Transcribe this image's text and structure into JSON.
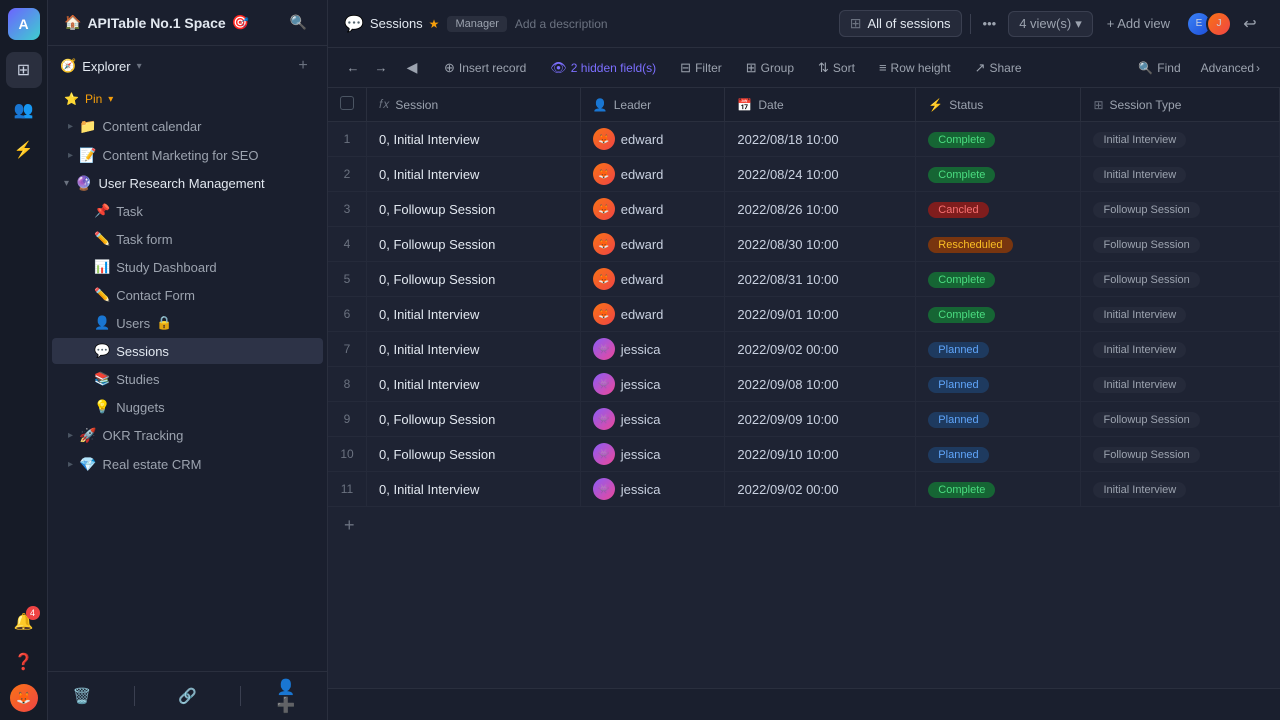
{
  "app": {
    "space_name": "APITable No.1 Space",
    "user_initial": "A"
  },
  "topbar": {
    "sessions_label": "Sessions",
    "star_label": "★",
    "manager_label": "Manager",
    "add_description": "Add a description",
    "view_name": "All of sessions",
    "view_count": "4 view(s)",
    "add_view": "+ Add view",
    "find_label": "Find",
    "advanced_label": "Advanced"
  },
  "toolbar": {
    "insert_record": "Insert record",
    "hidden_fields": "2 hidden field(s)",
    "filter": "Filter",
    "group": "Group",
    "sort": "Sort",
    "row_height": "Row height",
    "share": "Share"
  },
  "columns": [
    {
      "id": "session",
      "icon": "fx",
      "label": "Session"
    },
    {
      "id": "leader",
      "icon": "👤",
      "label": "Leader"
    },
    {
      "id": "date",
      "icon": "📅",
      "label": "Date"
    },
    {
      "id": "status",
      "icon": "⚡",
      "label": "Status"
    },
    {
      "id": "session_type",
      "icon": "⊞",
      "label": "Session Type"
    }
  ],
  "rows": [
    {
      "id": 1,
      "session": "0, Initial Interview",
      "leader": "edward",
      "leader_type": "ed",
      "date": "2022/08/18 10:00",
      "status": "Complete",
      "status_class": "status-complete",
      "session_type": "Initial Interview"
    },
    {
      "id": 2,
      "session": "0, Initial Interview",
      "leader": "edward",
      "leader_type": "ed",
      "date": "2022/08/24 10:00",
      "status": "Complete",
      "status_class": "status-complete",
      "session_type": "Initial Interview"
    },
    {
      "id": 3,
      "session": "0, Followup Session",
      "leader": "edward",
      "leader_type": "ed",
      "date": "2022/08/26 10:00",
      "status": "Cancled",
      "status_class": "status-cancelled",
      "session_type": "Followup Session"
    },
    {
      "id": 4,
      "session": "0, Followup Session",
      "leader": "edward",
      "leader_type": "ed",
      "date": "2022/08/30 10:00",
      "status": "Rescheduled",
      "status_class": "status-rescheduled",
      "session_type": "Followup Session"
    },
    {
      "id": 5,
      "session": "0, Followup Session",
      "leader": "edward",
      "leader_type": "ed",
      "date": "2022/08/31 10:00",
      "status": "Complete",
      "status_class": "status-complete",
      "session_type": "Followup Session"
    },
    {
      "id": 6,
      "session": "0, Initial Interview",
      "leader": "edward",
      "leader_type": "ed",
      "date": "2022/09/01 10:00",
      "status": "Complete",
      "status_class": "status-complete",
      "session_type": "Initial Interview"
    },
    {
      "id": 7,
      "session": "0, Initial Interview",
      "leader": "jessica",
      "leader_type": "jess",
      "date": "2022/09/02 00:00",
      "status": "Planned",
      "status_class": "status-planned",
      "session_type": "Initial Interview"
    },
    {
      "id": 8,
      "session": "0, Initial Interview",
      "leader": "jessica",
      "leader_type": "jess",
      "date": "2022/09/08 10:00",
      "status": "Planned",
      "status_class": "status-planned",
      "session_type": "Initial Interview"
    },
    {
      "id": 9,
      "session": "0, Followup Session",
      "leader": "jessica",
      "leader_type": "jess",
      "date": "2022/09/09 10:00",
      "status": "Planned",
      "status_class": "status-planned",
      "session_type": "Followup Session"
    },
    {
      "id": 10,
      "session": "0, Followup Session",
      "leader": "jessica",
      "leader_type": "jess",
      "date": "2022/09/10 10:00",
      "status": "Planned",
      "status_class": "status-planned",
      "session_type": "Followup Session"
    },
    {
      "id": 11,
      "session": "0, Initial Interview",
      "leader": "jessica",
      "leader_type": "jess",
      "date": "2022/09/02 00:00",
      "status": "Complete",
      "status_class": "status-complete",
      "session_type": "Initial Interview"
    }
  ],
  "sidebar": {
    "explorer_label": "Explorer",
    "pin_label": "Pin",
    "items": [
      {
        "id": "content-calendar",
        "icon": "📁",
        "label": "Content calendar",
        "has_chevron": true
      },
      {
        "id": "content-marketing",
        "icon": "📝",
        "label": "Content Marketing for SEO",
        "has_chevron": true
      },
      {
        "id": "user-research",
        "icon": "🔮",
        "label": "User Research Management",
        "expanded": true,
        "has_chevron": true
      }
    ],
    "user_research_children": [
      {
        "id": "task",
        "icon": "📌",
        "label": "Task"
      },
      {
        "id": "task-form",
        "icon": "✏️",
        "label": "Task form"
      },
      {
        "id": "study-dashboard",
        "icon": "📊",
        "label": "Study Dashboard"
      },
      {
        "id": "contact-form",
        "icon": "✏️",
        "label": "Contact Form"
      },
      {
        "id": "users",
        "icon": "👤",
        "label": "Users",
        "has_lock": true
      },
      {
        "id": "sessions",
        "icon": "💬",
        "label": "Sessions",
        "active": true
      },
      {
        "id": "studies",
        "icon": "📚",
        "label": "Studies"
      },
      {
        "id": "nuggets",
        "icon": "💡",
        "label": "Nuggets"
      }
    ],
    "bottom_items": [
      {
        "id": "okr-tracking",
        "icon": "🚀",
        "label": "OKR Tracking",
        "has_chevron": true
      },
      {
        "id": "real-estate",
        "icon": "💎",
        "label": "Real estate CRM",
        "has_chevron": true
      }
    ]
  },
  "icons": {
    "search": "🔍",
    "bell": "🔔",
    "help": "❓",
    "grid": "⊞",
    "chevron_down": "▾",
    "chevron_right": "▸",
    "chevron_left": "‹",
    "arrow_left": "←",
    "arrow_right": "→",
    "collapse": "◀",
    "undo": "↩",
    "plus": "+",
    "lock": "🔒",
    "eye": "👁",
    "funnel": "⊟",
    "bars": "≡",
    "sort": "⇅",
    "rows": "⊟",
    "share": "↗",
    "find": "🔍"
  }
}
